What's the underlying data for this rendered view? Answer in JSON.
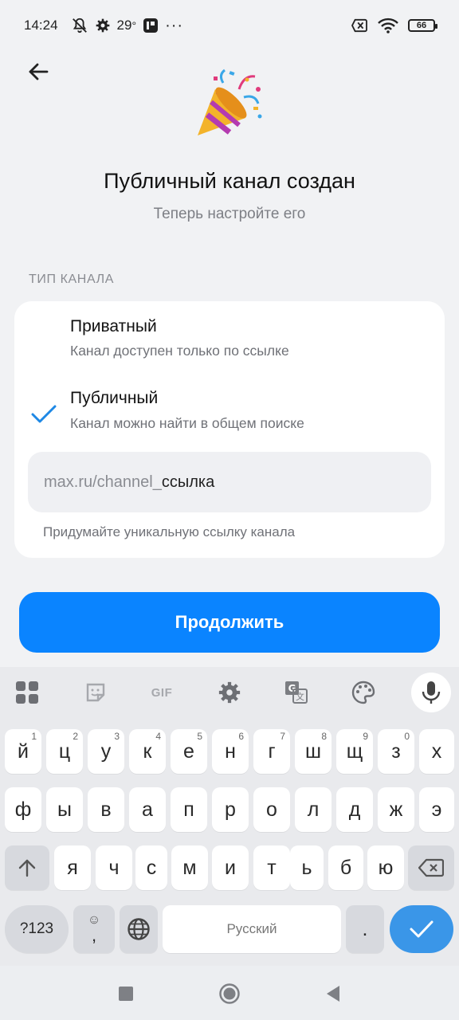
{
  "status_bar": {
    "time": "14:24",
    "temperature": "29",
    "degree": "°",
    "dots": "···",
    "battery": "66"
  },
  "header": {
    "title": "Публичный канал создан",
    "subtitle": "Теперь настройте его"
  },
  "channel_type": {
    "section_label": "ТИП КАНАЛА",
    "options": [
      {
        "title": "Приватный",
        "description": "Канал доступен только по ссылке",
        "selected": false
      },
      {
        "title": "Публичный",
        "description": "Канал можно найти в общем поиске",
        "selected": true
      }
    ],
    "link_prefix": "max.ru/channel_",
    "link_value": "ссылка",
    "hint": "Придумайте уникальную ссылку канала"
  },
  "continue_button": {
    "label": "Продолжить",
    "color": "#0a84ff"
  },
  "keyboard": {
    "toolbar": {
      "gif_label": "GIF"
    },
    "row1": [
      {
        "ch": "й",
        "n": "1"
      },
      {
        "ch": "ц",
        "n": "2"
      },
      {
        "ch": "у",
        "n": "3"
      },
      {
        "ch": "к",
        "n": "4"
      },
      {
        "ch": "е",
        "n": "5"
      },
      {
        "ch": "н",
        "n": "6"
      },
      {
        "ch": "г",
        "n": "7"
      },
      {
        "ch": "ш",
        "n": "8"
      },
      {
        "ch": "щ",
        "n": "9"
      },
      {
        "ch": "з",
        "n": "0"
      },
      {
        "ch": "х",
        "n": ""
      }
    ],
    "row2": [
      "ф",
      "ы",
      "в",
      "а",
      "п",
      "р",
      "о",
      "л",
      "д",
      "ж",
      "э"
    ],
    "row3": [
      "я",
      "ч",
      "с",
      "м",
      "и",
      "т",
      "ь",
      "б",
      "ю"
    ],
    "symbols_label": "?123",
    "comma": ",",
    "space_label": "Русский",
    "period": ".",
    "accent_color": "#3a96e8"
  }
}
